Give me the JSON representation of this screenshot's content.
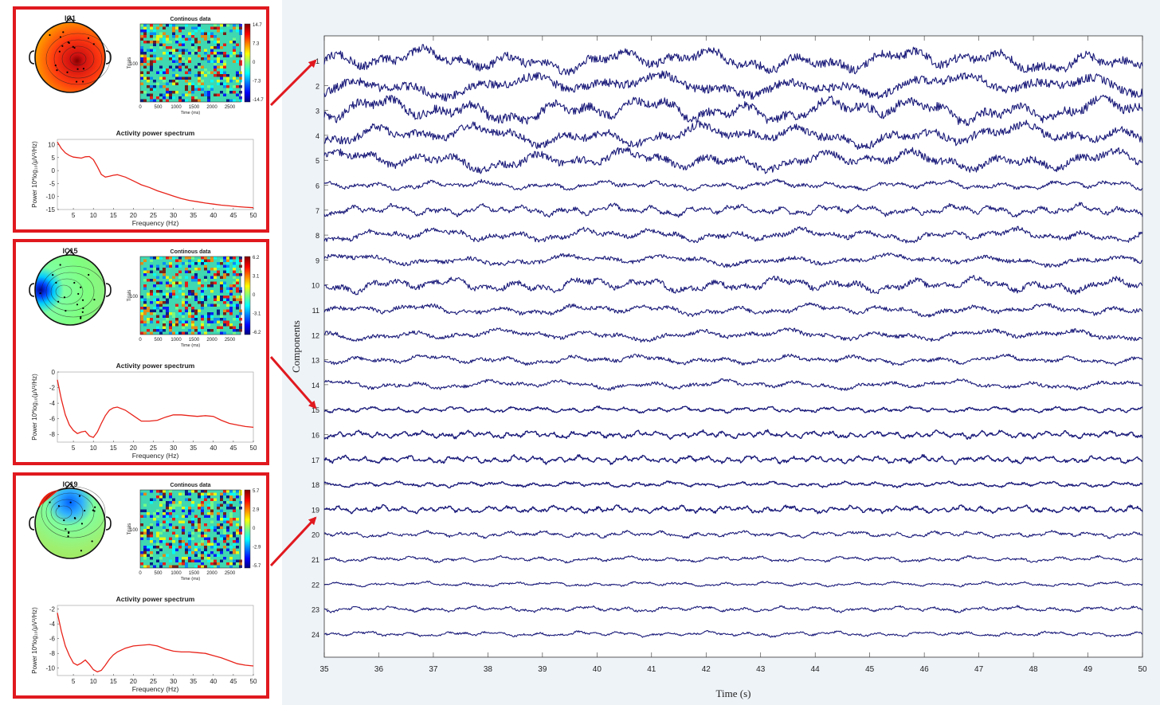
{
  "colors": {
    "frame": "#e0191f",
    "trace": "#1a1a7a",
    "spectrum": "#e8231a",
    "arrow": "#e0191f"
  },
  "panels": [
    {
      "ic_label": "IC1",
      "continuous_title": "Continous data",
      "trials_label": "Trials",
      "trial_tick": "100",
      "time_label": "Time (ms)",
      "time_ticks": [
        "0",
        "500",
        "1000",
        "1500",
        "2000",
        "2500"
      ],
      "colorbar_ticks": [
        "14.7",
        "7.3",
        "0",
        "-7.3",
        "-14.7"
      ],
      "spectrum_title": "Activity power spectrum",
      "freq_label": "Frequency (Hz)",
      "power_label": "Power 10*log₁₀(μV²/Hz)",
      "topomap": "red-dominant",
      "chart_data": {
        "type": "line",
        "xlim": [
          1,
          50
        ],
        "ylim": [
          -15,
          12
        ],
        "x_ticks": [
          5,
          10,
          15,
          20,
          25,
          30,
          35,
          40,
          45,
          50
        ],
        "y_ticks": [
          10,
          5,
          0,
          -5,
          -10,
          -15
        ],
        "x": [
          1,
          2,
          3,
          4,
          5,
          6,
          7,
          8,
          9,
          10,
          11,
          12,
          13,
          14,
          15,
          16,
          18,
          20,
          22,
          24,
          26,
          28,
          30,
          32,
          34,
          36,
          38,
          40,
          42,
          44,
          46,
          48,
          50
        ],
        "y": [
          11,
          8.5,
          6.8,
          5.8,
          5.2,
          5.0,
          4.8,
          5.3,
          5.4,
          4.2,
          1.5,
          -1.5,
          -2.5,
          -2.2,
          -1.8,
          -1.6,
          -2.5,
          -4.0,
          -5.5,
          -6.5,
          -7.8,
          -8.8,
          -9.8,
          -10.8,
          -11.5,
          -12.0,
          -12.5,
          -12.9,
          -13.3,
          -13.6,
          -13.9,
          -14.1,
          -14.3
        ]
      }
    },
    {
      "ic_label": "IC15",
      "continuous_title": "Continous data",
      "trials_label": "Trials",
      "trial_tick": "100",
      "time_label": "Time (ms)",
      "time_ticks": [
        "0",
        "500",
        "1000",
        "1500",
        "2000",
        "2500"
      ],
      "colorbar_ticks": [
        "6.2",
        "3.1",
        "0",
        "-3.1",
        "-6.2"
      ],
      "spectrum_title": "Activity power spectrum",
      "freq_label": "Frequency (Hz)",
      "power_label": "Power 10*log₁₀(μV²/Hz)",
      "topomap": "green-blue-left",
      "chart_data": {
        "type": "line",
        "xlim": [
          1,
          50
        ],
        "ylim": [
          -9,
          0
        ],
        "x_ticks": [
          5,
          10,
          15,
          20,
          25,
          30,
          35,
          40,
          45,
          50
        ],
        "y_ticks": [
          0,
          -2,
          -4,
          -6,
          -8
        ],
        "x": [
          1,
          2,
          3,
          4,
          5,
          6,
          7,
          8,
          9,
          10,
          11,
          12,
          13,
          14,
          15,
          16,
          18,
          20,
          22,
          24,
          26,
          28,
          30,
          32,
          34,
          36,
          38,
          40,
          42,
          44,
          46,
          48,
          50
        ],
        "y": [
          -1,
          -3.5,
          -5.5,
          -6.8,
          -7.5,
          -7.9,
          -7.7,
          -7.6,
          -8.2,
          -8.4,
          -7.7,
          -6.6,
          -5.6,
          -4.9,
          -4.6,
          -4.5,
          -4.9,
          -5.6,
          -6.3,
          -6.3,
          -6.2,
          -5.8,
          -5.5,
          -5.5,
          -5.6,
          -5.7,
          -5.6,
          -5.7,
          -6.2,
          -6.6,
          -6.8,
          -7.0,
          -7.1
        ]
      }
    },
    {
      "ic_label": "IC19",
      "continuous_title": "Continous data",
      "trials_label": "Trials",
      "trial_tick": "100",
      "time_label": "Time (ms)",
      "time_ticks": [
        "0",
        "500",
        "1000",
        "1500",
        "2000",
        "2500"
      ],
      "colorbar_ticks": [
        "5.7",
        "2.9",
        "0",
        "-2.9",
        "-5.7"
      ],
      "spectrum_title": "Activity power spectrum",
      "freq_label": "Frequency (Hz)",
      "power_label": "Power 10*log₁₀(μV²/Hz)",
      "topomap": "green-blue-top",
      "chart_data": {
        "type": "line",
        "xlim": [
          1,
          50
        ],
        "ylim": [
          -11,
          -1.5
        ],
        "x_ticks": [
          5,
          10,
          15,
          20,
          25,
          30,
          35,
          40,
          45,
          50
        ],
        "y_ticks": [
          -2,
          -4,
          -6,
          -8,
          -10
        ],
        "x": [
          1,
          2,
          3,
          4,
          5,
          6,
          7,
          8,
          9,
          10,
          11,
          12,
          13,
          14,
          15,
          16,
          18,
          20,
          22,
          24,
          26,
          28,
          30,
          32,
          34,
          36,
          38,
          40,
          42,
          44,
          46,
          48,
          50
        ],
        "y": [
          -2.5,
          -5,
          -7,
          -8.3,
          -9.3,
          -9.6,
          -9.3,
          -8.9,
          -9.5,
          -10.2,
          -10.5,
          -10.3,
          -9.6,
          -8.8,
          -8.2,
          -7.8,
          -7.3,
          -7.0,
          -6.9,
          -6.8,
          -7.0,
          -7.4,
          -7.7,
          -7.8,
          -7.8,
          -7.9,
          -8.0,
          -8.3,
          -8.6,
          -9.0,
          -9.4,
          -9.6,
          -9.7
        ]
      }
    }
  ],
  "main": {
    "xlabel": "Time (s)",
    "ylabel": "Components",
    "chart_data": {
      "type": "line",
      "xlim": [
        35,
        50
      ],
      "x_ticks": [
        35,
        36,
        37,
        38,
        39,
        40,
        41,
        42,
        43,
        44,
        45,
        46,
        47,
        48,
        49,
        50
      ],
      "components": [
        "1",
        "2",
        "3",
        "4",
        "5",
        "6",
        "7",
        "8",
        "9",
        "10",
        "11",
        "12",
        "13",
        "14",
        "15",
        "16",
        "17",
        "18",
        "19",
        "20",
        "21",
        "22",
        "23",
        "24"
      ]
    }
  }
}
